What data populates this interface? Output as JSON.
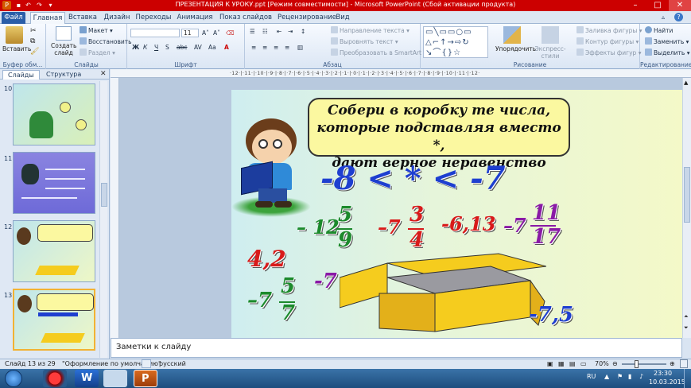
{
  "window": {
    "title": "ПРЕЗЕНТАЦИЯ К УРОКУ.ppt [Режим совместимости] - Microsoft PowerPoint (Сбой активации продукта)"
  },
  "tabs": [
    "Файл",
    "Главная",
    "Вставка",
    "Дизайн",
    "Переходы",
    "Анимация",
    "Показ слайдов",
    "Рецензирование",
    "Вид"
  ],
  "ribbon": {
    "paste": "Вставить",
    "clipboard_label": "Буфер обм...",
    "create_slide": "Создать",
    "create_slide2": "слайд",
    "layout": "Макет",
    "reset": "Восстановить",
    "section": "Раздел",
    "slides_label": "Слайды",
    "font_size": "11",
    "font_label": "Шрифт",
    "text_direction": "Направление текста",
    "align_text": "Выровнять текст",
    "smartart": "Преобразовать в SmartArt",
    "paragraph_label": "Абзац",
    "arrange": "Упорядочить",
    "quick_styles": "Экспресс-стили",
    "fill": "Заливка фигуры",
    "outline": "Контур фигуры",
    "effects": "Эффекты фигур",
    "drawing_label": "Рисование",
    "find": "Найти",
    "replace": "Заменить",
    "select": "Выделить",
    "editing_label": "Редактирование"
  },
  "panel": {
    "tab_slides": "Слайды",
    "tab_outline": "Структура",
    "thumbs": [
      {
        "num": "10"
      },
      {
        "num": "11"
      },
      {
        "num": "12"
      },
      {
        "num": "13"
      }
    ]
  },
  "ruler": "·12·|·11·|·10·|·9·|·8·|·7·|·6·|·5·|·4·|·3·|·2·|·1·|·0·|·1·|·2·|·3·|·4·|·5·|·6·|·7·|·8·|·9·|·10·|·11·|·12·",
  "slide": {
    "bubble": [
      "Собери в коробку те числа,",
      "которые подставляя вместо *,",
      "дают верное неравенство"
    ],
    "inequality": "-8 < * < -7",
    "n1": {
      "whole": "– 12",
      "num": "5",
      "den": "9"
    },
    "n2": {
      "whole": "–7",
      "num": "3",
      "den": "4"
    },
    "n3": "-6,13",
    "n4": {
      "whole": "–7",
      "num": "11",
      "den": "17"
    },
    "n5": "4,2",
    "n6": "-7",
    "n7": {
      "whole": "–7",
      "num": "5",
      "den": "7"
    },
    "n8": "-7,5"
  },
  "notes": {
    "placeholder": "Заметки к слайду"
  },
  "status": {
    "slide": "Слайд 13 из 29",
    "theme": "\"Оформление по умолчанию\"",
    "lang": "русский",
    "zoom": "70%",
    "zoom_level": 0.7
  },
  "taskbar": {
    "lang": "RU",
    "time": "23:30",
    "date": "10.03.2015"
  },
  "colors": {
    "titlebar": "#cc0000",
    "slide_blue": "#1e3fd0",
    "slide_red": "#d81a1a",
    "slide_green": "#1c8a2c",
    "slide_purple": "#8a1aa6",
    "box": "#f5cc1e"
  }
}
